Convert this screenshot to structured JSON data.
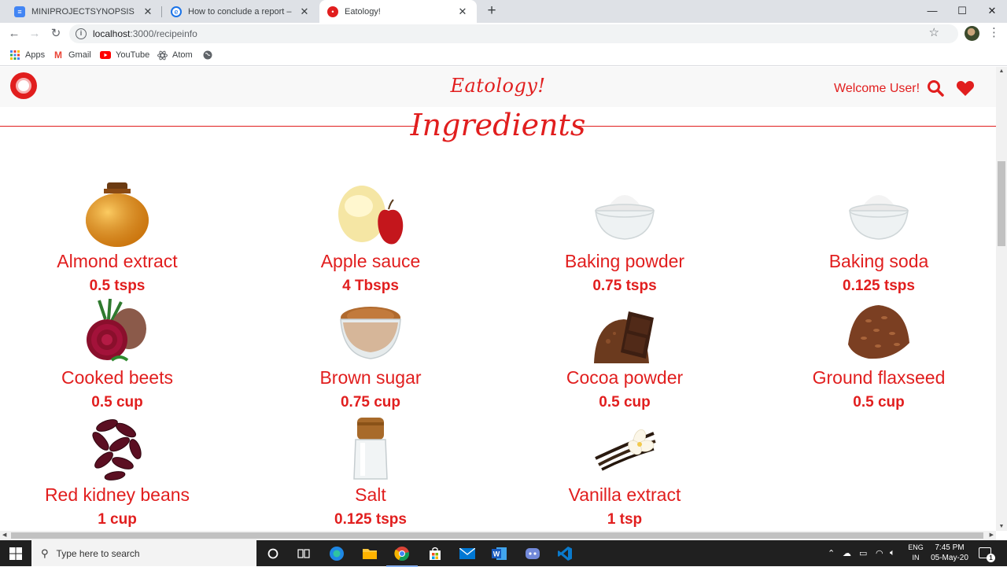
{
  "browser": {
    "tabs": [
      {
        "title": "MINIPROJECTSYNOPSIS - Google",
        "icon": "google-docs-icon"
      },
      {
        "title": "How to conclude a report – like a",
        "icon": "edge-icon"
      },
      {
        "title": "Eatology!",
        "icon": "eatology-favicon"
      }
    ],
    "url_host": "localhost",
    "url_path": ":3000/recipeinfo",
    "bookmarks": [
      {
        "label": "Apps",
        "icon": "apps-grid-icon"
      },
      {
        "label": "Gmail",
        "icon": "gmail-icon"
      },
      {
        "label": "YouTube",
        "icon": "youtube-icon"
      },
      {
        "label": "Atom",
        "icon": "atom-icon"
      }
    ]
  },
  "site": {
    "brand": "Eatology!",
    "welcome": "Welcome User!",
    "heading": "Ingredients",
    "accent_color": "#e11e1e"
  },
  "ingredients": [
    {
      "name": "Almond extract",
      "qty": "0.5 tsps",
      "icon": "amber-jar"
    },
    {
      "name": "Apple sauce",
      "qty": "4 Tbsps",
      "icon": "apple-sauce"
    },
    {
      "name": "Baking powder",
      "qty": "0.75 tsps",
      "icon": "white-powder-bowl"
    },
    {
      "name": "Baking soda",
      "qty": "0.125 tsps",
      "icon": "white-powder-bowl"
    },
    {
      "name": "Cooked beets",
      "qty": "0.5 cup",
      "icon": "beets"
    },
    {
      "name": "Brown sugar",
      "qty": "0.75 cup",
      "icon": "brown-sugar-bowl"
    },
    {
      "name": "Cocoa powder",
      "qty": "0.5 cup",
      "icon": "cocoa-chocolate"
    },
    {
      "name": "Ground flaxseed",
      "qty": "0.5 cup",
      "icon": "flaxseed-pile"
    },
    {
      "name": "Red kidney beans",
      "qty": "1 cup",
      "icon": "kidney-beans"
    },
    {
      "name": "Salt",
      "qty": "0.125 tsps",
      "icon": "salt-shaker"
    },
    {
      "name": "Vanilla extract",
      "qty": "1 tsp",
      "icon": "vanilla-pods"
    }
  ],
  "taskbar": {
    "search_placeholder": "Type here to search",
    "lang_line1": "ENG",
    "lang_line2": "IN",
    "time": "7:45 PM",
    "date": "05-May-20",
    "notification_count": "1"
  }
}
